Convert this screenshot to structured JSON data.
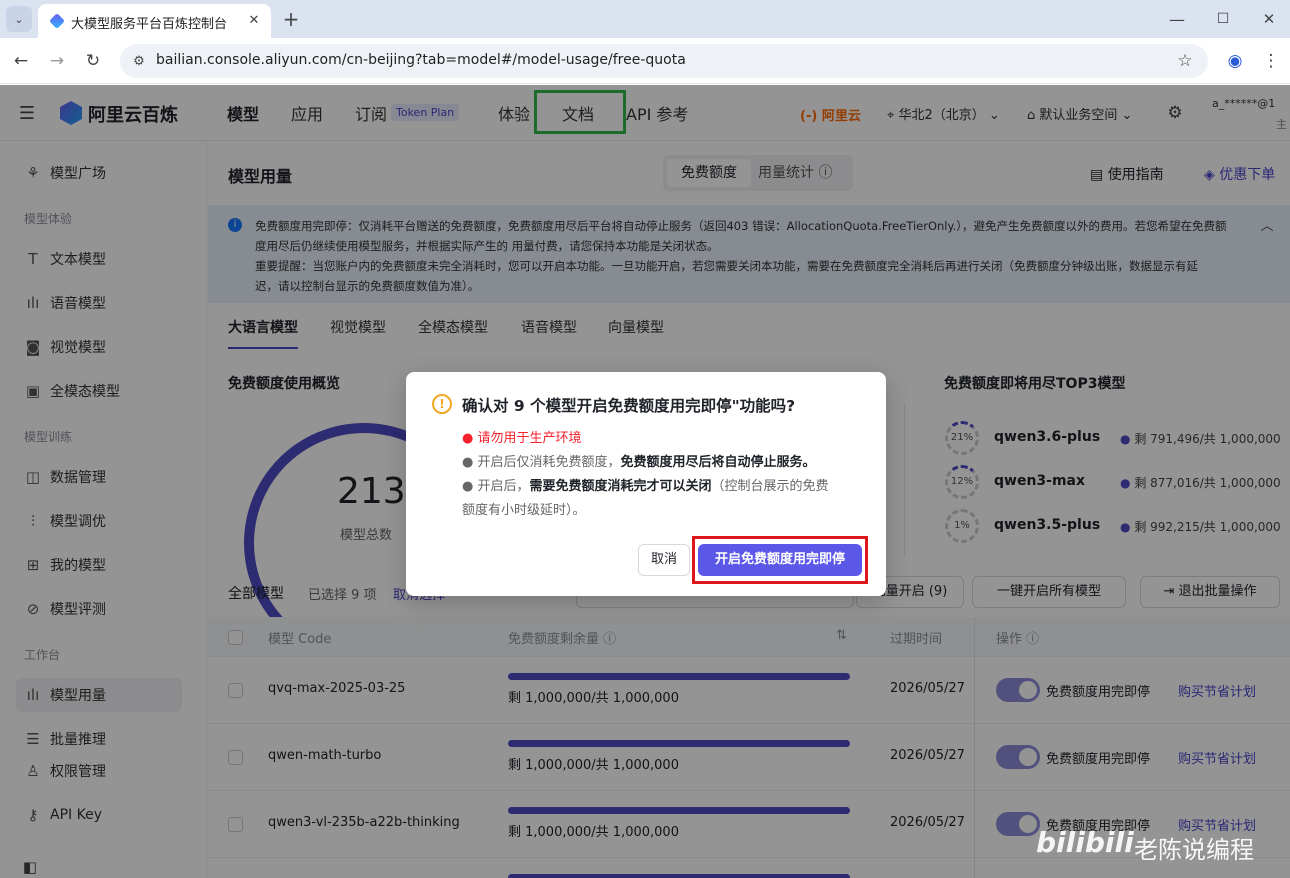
{
  "browser": {
    "tab_title": "大模型服务平台百炼控制台",
    "url": "bailian.console.aliyun.com/cn-beijing?tab=model#/model-usage/free-quota"
  },
  "header": {
    "logo_text": "阿里云百炼",
    "nav": [
      "模型",
      "应用",
      "订阅",
      "体验",
      "文档",
      "API 参考"
    ],
    "token_plan": "Token Plan",
    "aliyun": "阿里云",
    "region": "华北2（北京）",
    "workspace": "默认业务空间",
    "account": "a_******@1",
    "account_sub": "主"
  },
  "sidebar": {
    "items": [
      {
        "label": "模型广场"
      },
      {
        "label": "文本模型"
      },
      {
        "label": "语音模型"
      },
      {
        "label": "视觉模型"
      },
      {
        "label": "全模态模型"
      },
      {
        "label": "数据管理"
      },
      {
        "label": "模型调优"
      },
      {
        "label": "我的模型"
      },
      {
        "label": "模型评测"
      },
      {
        "label": "模型用量"
      },
      {
        "label": "批量推理"
      },
      {
        "label": "权限管理"
      },
      {
        "label": "API Key"
      }
    ],
    "groups": [
      "模型体验",
      "模型训练",
      "工作台"
    ]
  },
  "main": {
    "title": "模型用量",
    "switch": [
      "免费额度",
      "用量统计"
    ],
    "guide": "使用指南",
    "discount": "优惠下单",
    "notice": {
      "line1": "免费额度用完即停：仅消耗平台赠送的免费额度，免费额度用尽后平台将自动停止服务（返回403 错误：AllocationQuota.FreeTierOnly.），避免产生免费额度以外的费用。若您希望在免费额",
      "line2": "度用尽后仍继续使用模型服务，并根据实际产生的 用量付费，请您保持本功能是关闭状态。",
      "line3": "重要提醒：当您账户内的免费额度未完全消耗时，您可以开启本功能。一旦功能开启，若您需要关闭本功能，需要在免费额度完全消耗后再进行关闭（免费额度分钟级出账，数据显示有延",
      "line4": "迟，请以控制台显示的免费额度数值为准）。"
    },
    "tabs": [
      "大语言模型",
      "视觉模型",
      "全模态模型",
      "语音模型",
      "向量模型"
    ],
    "overview_title": "免费额度使用概览",
    "total": "213",
    "total_label": "模型总数",
    "top3_title": "免费额度即将用尽TOP3模型",
    "top3": [
      {
        "pct": "21%",
        "name": "qwen3.6-plus",
        "remain": "剩 791,496/共 1,000,000"
      },
      {
        "pct": "12%",
        "name": "qwen3-max",
        "remain": "剩 877,016/共 1,000,000"
      },
      {
        "pct": "1%",
        "name": "qwen3.5-plus",
        "remain": "剩 992,215/共 1,000,000"
      }
    ],
    "toolbar": {
      "all_models": "全部模型",
      "selected": "已选择 9 项",
      "cancel_select": "取消选择",
      "batch_enable": "批量开启 (9)",
      "enable_all": "一键开启所有模型",
      "exit_batch": "退出批量操作"
    },
    "columns": [
      "模型 Code",
      "免费额度剩余量",
      "过期时间",
      "操作"
    ],
    "rows": [
      {
        "code": "qvq-max-2025-03-25",
        "remain": "剩 1,000,000/共 1,000,000",
        "expire": "2026/05/27",
        "toggle": "免费额度用完即停",
        "buy": "购买节省计划"
      },
      {
        "code": "qwen-math-turbo",
        "remain": "剩 1,000,000/共 1,000,000",
        "expire": "2026/05/27",
        "toggle": "免费额度用完即停",
        "buy": "购买节省计划"
      },
      {
        "code": "qwen3-vl-235b-a22b-thinking",
        "remain": "剩 1,000,000/共 1,000,000",
        "expire": "2026/05/27",
        "toggle": "免费额度用完即停",
        "buy": "购买节省计划"
      }
    ]
  },
  "dialog": {
    "title": "确认对 9 个模型开启免费额度用完即停\"功能吗?",
    "warn": "● 请勿用于生产环境",
    "l1a": "● 开启后仅消耗免费额度，",
    "l1b": "免费额度用尽后将自动停止服务。",
    "l2a": "● 开启后，",
    "l2b": "需要免费额度消耗完才可以关闭",
    "l2c": "（控制台展示的免费",
    "l3": "额度有小时级延时）。",
    "cancel": "取消",
    "confirm": "开启免费额度用完即停"
  },
  "watermark": {
    "logo": "bilibili",
    "author": "老陈说编程"
  }
}
